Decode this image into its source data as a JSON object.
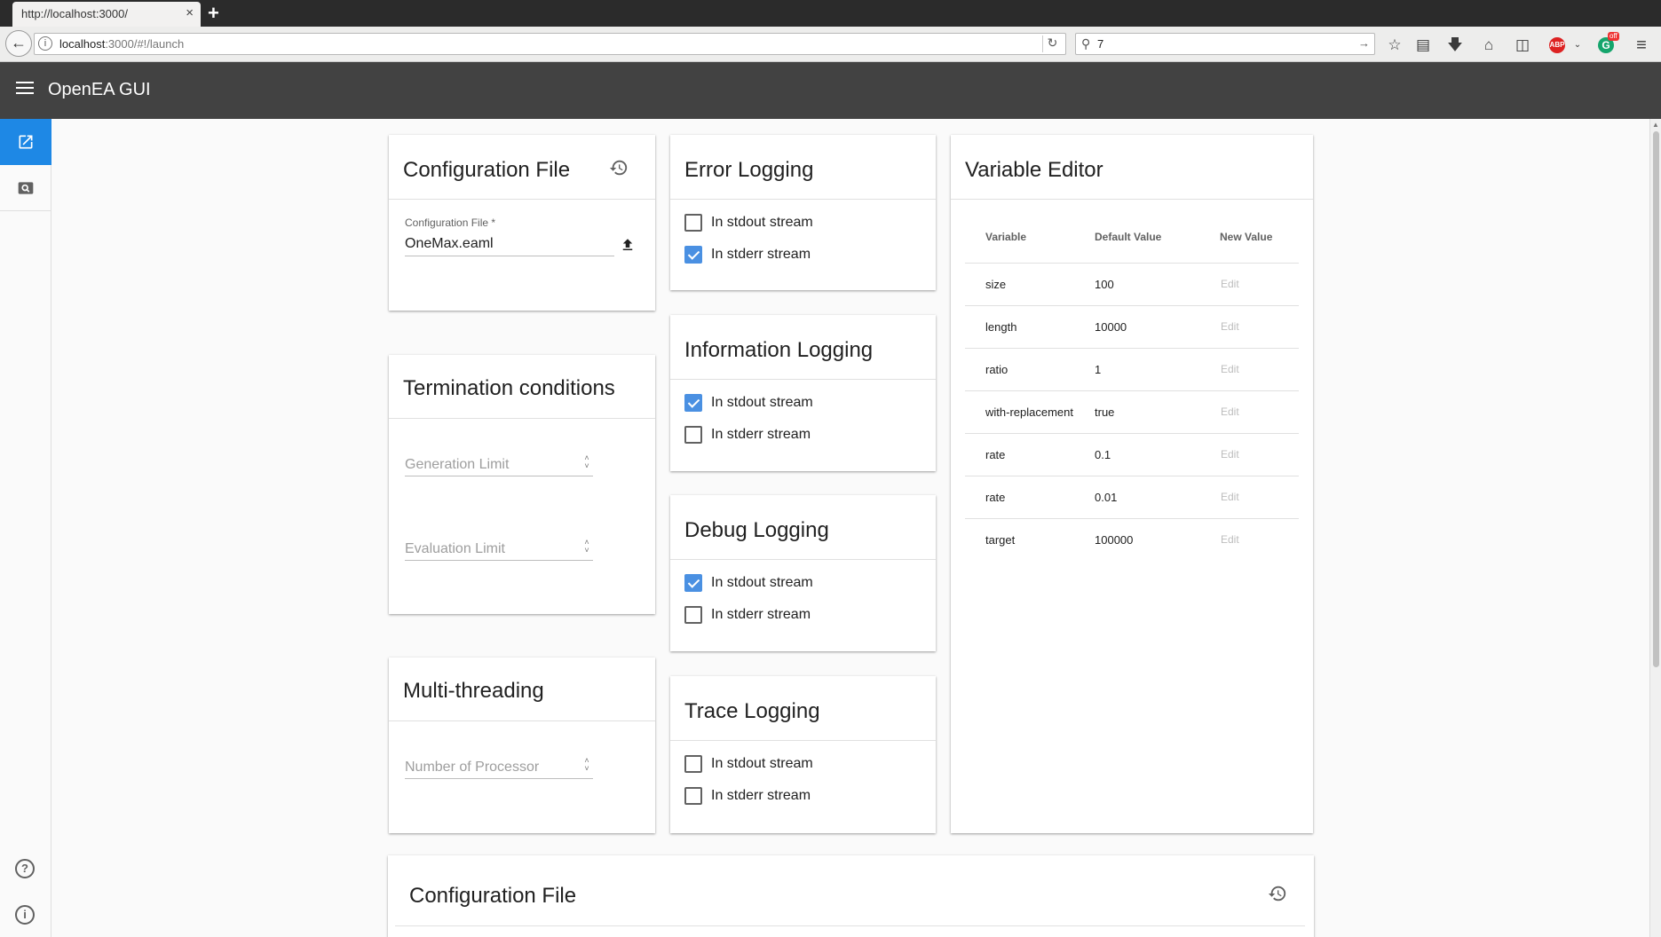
{
  "browser": {
    "tab_title": "http://localhost:3000/",
    "tab_close": "×",
    "new_tab": "+",
    "url_host": "localhost",
    "url_path": ":3000/#!/launch",
    "search_value": "7",
    "abp_label": "ABP",
    "grammarly_badge": "off"
  },
  "app": {
    "title": "OpenEA GUI"
  },
  "config_card": {
    "title": "Configuration File",
    "field_label": "Configuration File *",
    "field_value": "OneMax.eaml"
  },
  "termination_card": {
    "title": "Termination conditions",
    "generation_placeholder": "Generation Limit",
    "evaluation_placeholder": "Evaluation Limit"
  },
  "multithreading_card": {
    "title": "Multi-threading",
    "processor_placeholder": "Number of Processor"
  },
  "logging": [
    {
      "title": "Error Logging",
      "stdout_label": "In stdout stream",
      "stdout_checked": false,
      "stderr_label": "In stderr stream",
      "stderr_checked": true
    },
    {
      "title": "Information Logging",
      "stdout_label": "In stdout stream",
      "stdout_checked": true,
      "stderr_label": "In stderr stream",
      "stderr_checked": false
    },
    {
      "title": "Debug Logging",
      "stdout_label": "In stdout stream",
      "stdout_checked": true,
      "stderr_label": "In stderr stream",
      "stderr_checked": false
    },
    {
      "title": "Trace Logging",
      "stdout_label": "In stdout stream",
      "stdout_checked": false,
      "stderr_label": "In stderr stream",
      "stderr_checked": false
    }
  ],
  "variable_editor": {
    "title": "Variable Editor",
    "headers": [
      "Variable",
      "Default Value",
      "New Value"
    ],
    "rows": [
      {
        "variable": "size",
        "default": "100",
        "action": "Edit"
      },
      {
        "variable": "length",
        "default": "10000",
        "action": "Edit"
      },
      {
        "variable": "ratio",
        "default": "1",
        "action": "Edit"
      },
      {
        "variable": "with-replacement",
        "default": "true",
        "action": "Edit"
      },
      {
        "variable": "rate",
        "default": "0.1",
        "action": "Edit"
      },
      {
        "variable": "rate",
        "default": "0.01",
        "action": "Edit"
      },
      {
        "variable": "target",
        "default": "100000",
        "action": "Edit"
      }
    ]
  },
  "bottom_card": {
    "title": "Configuration File"
  },
  "colors": {
    "appbar": "#424242",
    "accent": "#1e88e5",
    "checkbox_checked": "#4a90e2"
  }
}
